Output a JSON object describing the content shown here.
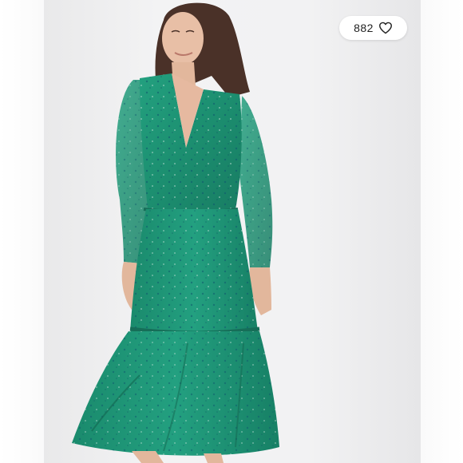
{
  "listing": {
    "like_count": "882",
    "like_icon": "heart-outline-icon",
    "photo_subject": "model",
    "colors": {
      "background": "#f2f2f3",
      "dress": "#1f9474",
      "badge": "#ffffff",
      "text": "#222222"
    }
  }
}
